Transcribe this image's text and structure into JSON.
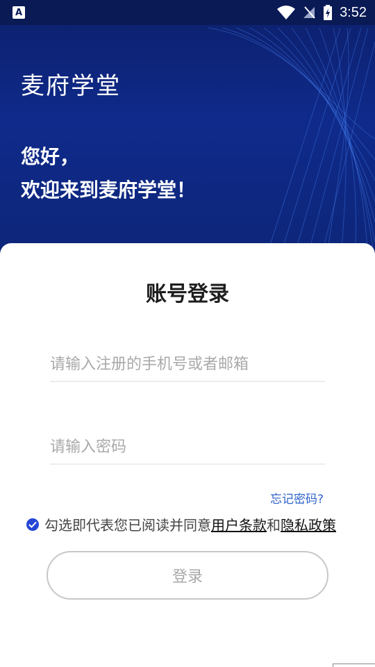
{
  "status_bar": {
    "time": "3:52",
    "app_badge": "A"
  },
  "hero": {
    "brand": "麦府学堂",
    "greeting_line1": "您好，",
    "greeting_line2": "欢迎来到麦府学堂！"
  },
  "login": {
    "title": "账号登录",
    "phone_placeholder": "请输入注册的手机号或者邮箱",
    "password_placeholder": "请输入密码",
    "forgot": "忘记密码?",
    "agree_prefix": "勾选即代表您已阅读并同意",
    "terms": "用户条款",
    "and": "和",
    "privacy": "隐私政策",
    "button": "登录"
  },
  "colors": {
    "hero_bg": "#0f2a8a",
    "accent": "#2446d6",
    "link": "#2e63c9"
  }
}
